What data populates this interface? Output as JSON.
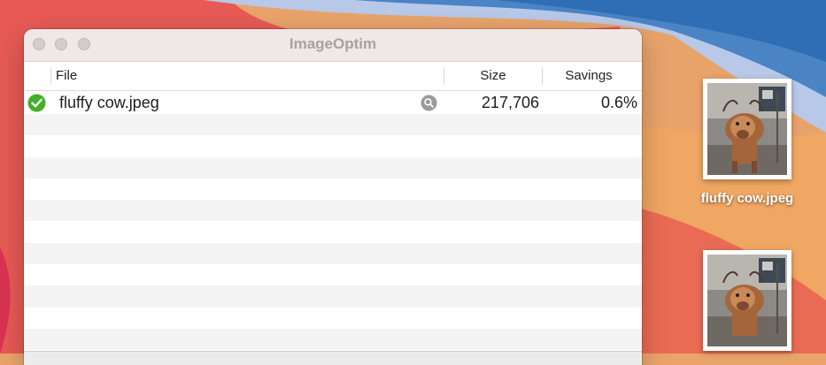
{
  "window": {
    "title": "ImageOptim"
  },
  "table": {
    "columns": {
      "file": "File",
      "size": "Size",
      "savings": "Savings"
    },
    "rows": [
      {
        "status": "check-circle-icon",
        "name": "fluffy cow.jpeg",
        "size": "217,706",
        "savings": "0.6%"
      }
    ]
  },
  "desktop": {
    "icons": [
      {
        "label": "fluffy cow.jpeg"
      }
    ]
  },
  "colors": {
    "success": "#43b02a",
    "title_text": "#a7a1a1",
    "row_alt": "#f4f4f4"
  }
}
